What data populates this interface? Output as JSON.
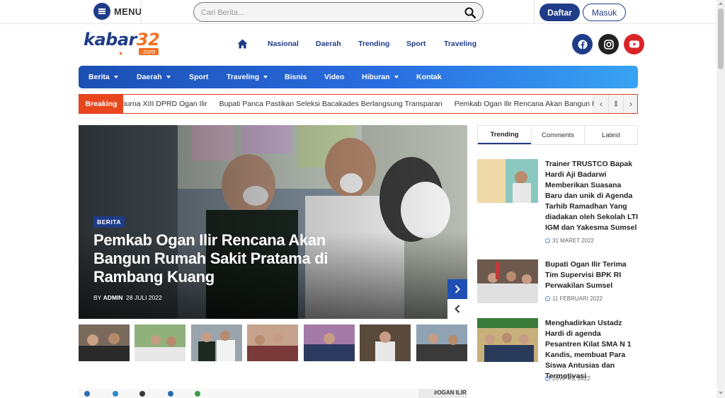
{
  "topbar": {
    "menu_label": "MENU",
    "search_placeholder": "Cari Berita...",
    "register_label": "Daftar",
    "login_label": "Masuk"
  },
  "brand": {
    "logo_main": "kabar",
    "logo_number": "32",
    "logo_suffix": ".com",
    "primary_color": "#1f3c88",
    "accent_color": "#f36f21"
  },
  "header_nav": [
    "Nasional",
    "Daerah",
    "Trending",
    "Sport",
    "Traveling"
  ],
  "social": [
    {
      "name": "facebook-icon",
      "color": "#1f3c88"
    },
    {
      "name": "instagram-icon",
      "color": "#222222"
    },
    {
      "name": "youtube-icon",
      "color": "#d9252a"
    }
  ],
  "main_nav": [
    {
      "label": "Berita",
      "dropdown": true
    },
    {
      "label": "Daerah",
      "dropdown": true
    },
    {
      "label": "Sport",
      "dropdown": false
    },
    {
      "label": "Traveling",
      "dropdown": true
    },
    {
      "label": "Bisnis",
      "dropdown": false
    },
    {
      "label": "Video",
      "dropdown": false
    },
    {
      "label": "Hiburan",
      "dropdown": true
    },
    {
      "label": "Kontak",
      "dropdown": false
    }
  ],
  "breaking": {
    "label": "Breaking",
    "items": [
      "ripurna XIII DPRD Ogan Ilir",
      "Bupati Panca Pastikan Seleksi Bacakades Berlangsung Transparan",
      "Pemkab Ogan Ilir Rencana Akan Bangun Rumah Sa"
    ]
  },
  "hero": {
    "category": "BERITA",
    "title": "Pemkab Ogan Ilir Rencana Akan Bangun Rumah Sakit Pratama di Rambang Kuang",
    "by_prefix": "BY",
    "author": "ADMIN",
    "date": "28 JULI 2022"
  },
  "sidebar": {
    "tabs": [
      "Trending",
      "Comments",
      "Latest"
    ],
    "active_tab": "Trending",
    "items": [
      {
        "title": "Trainer TRUSTCO Bapak Hardi Aji Badarwi Memberikan Suasana Baru dan unik di Agenda Tarhib Ramadhan Yang diadakan oleh Sekolah LTI IGM dan Yakesma Sumsel",
        "date": "31 MARET 2022"
      },
      {
        "title": "Bupati Ogan Ilir Terima Tim Supervisi BPK RI Perwakilan Sumsel",
        "date": "11 FEBRUARI 2022"
      },
      {
        "title": "Menghadirkan Ustadz Hardi di agenda Pesantren Kilat SMA N 1 Kandis, membuat Para Siswa Antusias dan Termotivasi",
        "date": "20 APRIL 2022"
      }
    ]
  },
  "banner": {
    "tag": "#OGAN ILIR"
  }
}
